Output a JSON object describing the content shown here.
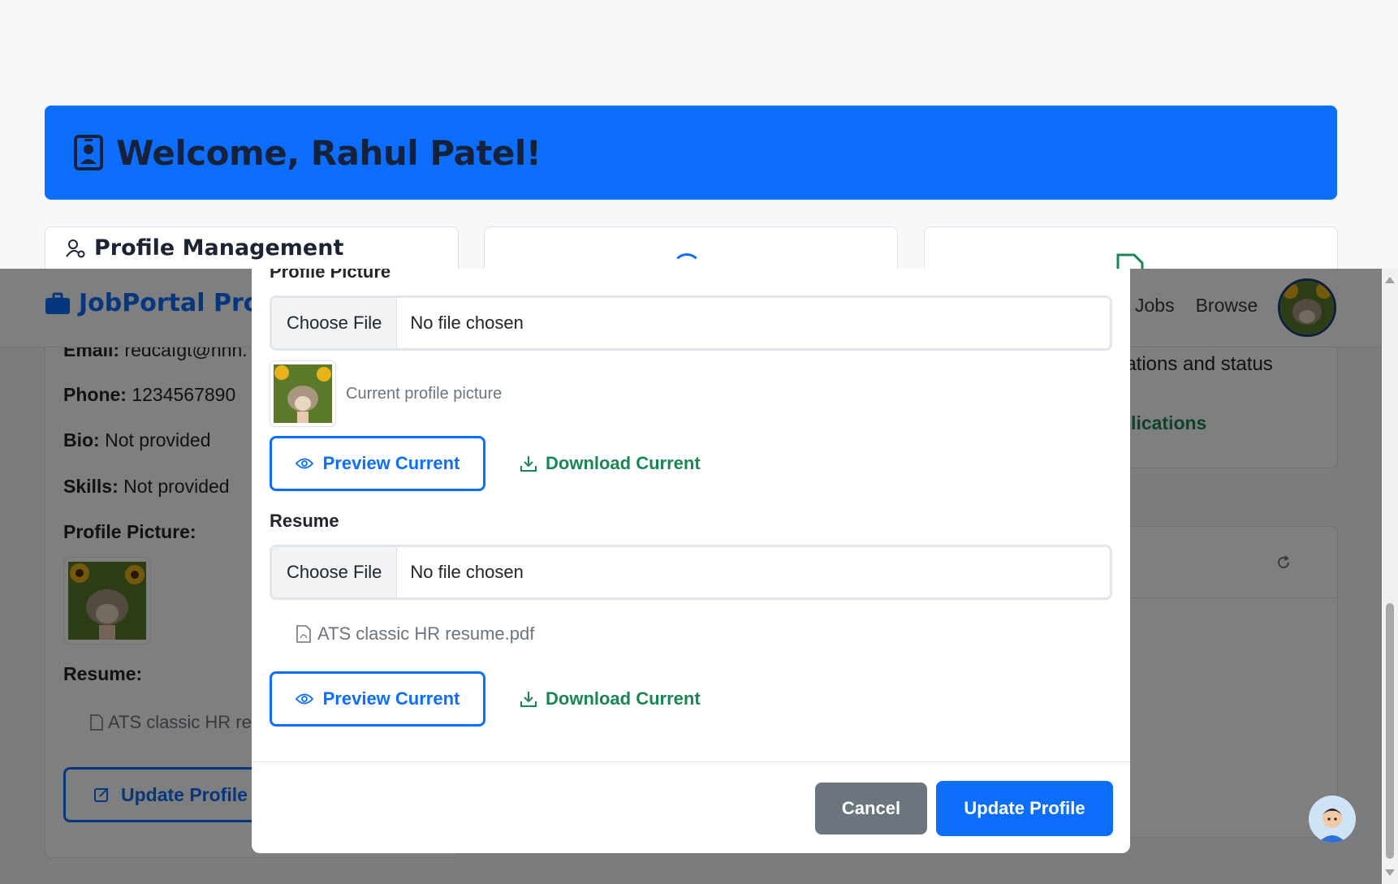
{
  "welcome": {
    "title": "Welcome, Rahul Patel!"
  },
  "profile_card": {
    "heading": "Profile Management",
    "email_label": "Email:",
    "email_value": "redcafgt@hhh.",
    "phone_label": "Phone:",
    "phone_value": "1234567890",
    "bio_label": "Bio:",
    "bio_value": "Not provided",
    "skills_label": "Skills:",
    "skills_value": "Not provided",
    "picture_label": "Profile Picture:",
    "resume_label": "Resume:",
    "resume_file": "ATS classic HR re",
    "update_button": "Update Profile"
  },
  "right_card": {
    "text": "ications and status",
    "link": "plications"
  },
  "navbar": {
    "brand": "JobPortal Pro",
    "links": [
      "Jobs",
      "Browse"
    ]
  },
  "modal": {
    "picture_label": "Profile Picture",
    "picture_input": {
      "button": "Choose File",
      "status": "No file chosen"
    },
    "current_picture_caption": "Current profile picture",
    "preview_label": "Preview Current",
    "download_label": "Download Current",
    "resume_label": "Resume",
    "resume_input": {
      "button": "Choose File",
      "status": "No file chosen"
    },
    "resume_file": "ATS classic HR resume.pdf",
    "cancel_label": "Cancel",
    "update_label": "Update Profile"
  },
  "colors": {
    "primary": "#0d6efd",
    "success": "#198754",
    "secondary": "#6c757d"
  }
}
